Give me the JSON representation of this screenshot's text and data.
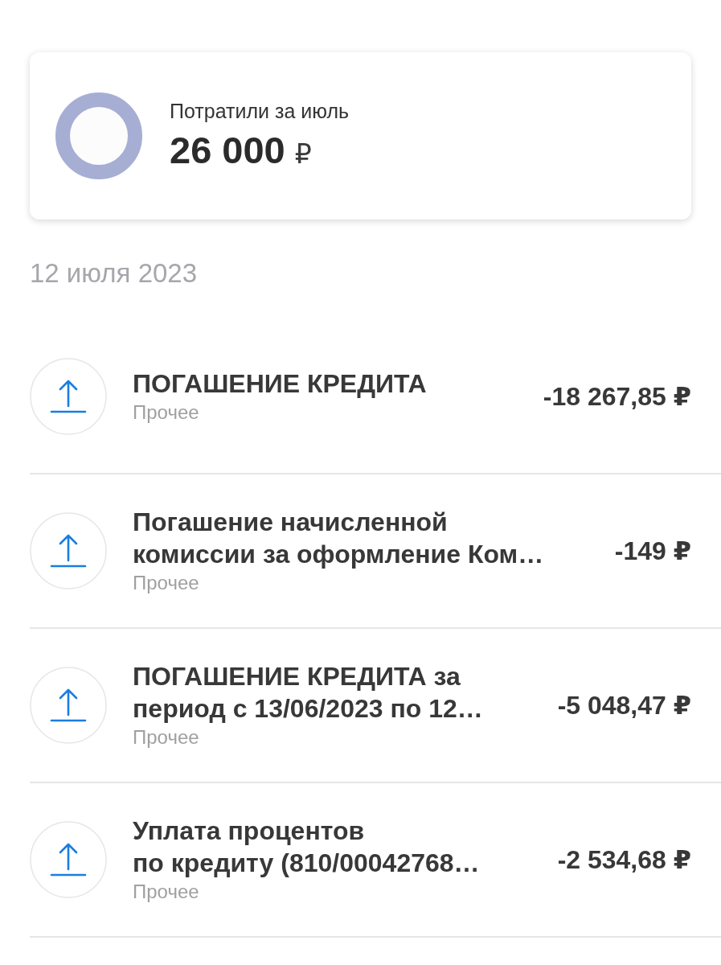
{
  "summary": {
    "label": "Потратили за июль",
    "amount": "26 000",
    "currency": "₽"
  },
  "date_heading": "12 июля 2023",
  "transactions": [
    {
      "title_lines": [
        "ПОГАШЕНИЕ КРЕДИТА"
      ],
      "category": "Прочее",
      "amount": "-18 267,85 ₽"
    },
    {
      "title_lines": [
        "Погашение начисленной",
        "комиссии за оформление Ком…"
      ],
      "category": "Прочее",
      "amount": "-149 ₽"
    },
    {
      "title_lines": [
        "ПОГАШЕНИЕ КРЕДИТА за",
        "период с 13/06/2023 по 12…"
      ],
      "category": "Прочее",
      "amount": "-5 048,47 ₽"
    },
    {
      "title_lines": [
        "Уплата процентов",
        "по кредиту (810/00042768…"
      ],
      "category": "Прочее",
      "amount": "-2 534,68 ₽"
    }
  ]
}
